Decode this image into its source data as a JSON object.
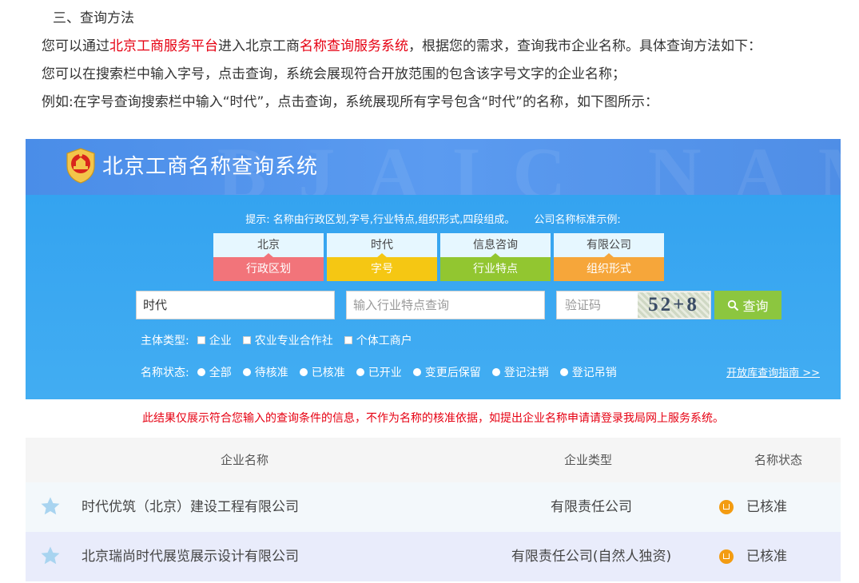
{
  "intro": {
    "section_title": "三、查询方法",
    "line1_a": "您可以通过",
    "line1_link1": "北京工商服务平台",
    "line1_b": "进入北京工商",
    "line1_link2": "名称查询服务系统",
    "line1_c": "，根据您的需求，查询我市企业名称。具体查询方法如下：",
    "line2": "您可以在搜索栏中输入字号，点击查询，系统会展现符合开放范围的包含该字号文字的企业名称；",
    "line3": "例如:在字号查询搜索栏中输入“时代”，点击查询，系统展现所有字号包含“时代”的名称，如下图所示："
  },
  "system": {
    "title": "北京工商名称查询系统",
    "banner_watermark": "BJAIC NAME"
  },
  "tip": {
    "a": "提示: 名称由行政区划,字号,行业特点,组织形式,四段组成。",
    "b": "公司名称标准示例:"
  },
  "name_parts": [
    {
      "example": "北京",
      "label": "行政区划",
      "color": "#f2747a"
    },
    {
      "example": "时代",
      "label": "字号",
      "color": "#f5c713"
    },
    {
      "example": "信息咨询",
      "label": "行业特点",
      "color": "#92c630"
    },
    {
      "example": "有限公司",
      "label": "组织形式",
      "color": "#f6a63a"
    }
  ],
  "search": {
    "name_value": "时代",
    "industry_placeholder": "输入行业特点查询",
    "captcha_placeholder": "验证码",
    "captcha_text": "52+8",
    "button_label": "查询"
  },
  "filters": {
    "entity_label": "主体类型:",
    "entity_options": [
      "企业",
      "农业专业合作社",
      "个体工商户"
    ],
    "status_label": "名称状态:",
    "status_options": [
      "全部",
      "待核准",
      "已核准",
      "已开业",
      "变更后保留",
      "登记注销",
      "登记吊销"
    ],
    "guide_link": "开放库查询指南 >>"
  },
  "notice": "此结果仅展示符合您输入的查询条件的信息，不作为名称的核准依据，如提出企业名称申请请登录我局网上服务系统。",
  "table": {
    "headers": {
      "name": "企业名称",
      "type": "企业类型",
      "status": "名称状态"
    },
    "rows": [
      {
        "name": "时代优筑（北京）建设工程有限公司",
        "type": "有限责任公司",
        "status": "已核准"
      },
      {
        "name": "北京瑞尚时代展览展示设计有限公司",
        "type": "有限责任公司(自然人独资)",
        "status": "已核准"
      }
    ]
  },
  "colors": {
    "accent_red": "#e60012",
    "banner_blue": "#4a8de8",
    "search_blue": "#3da8f0",
    "button_green": "#8cc63f",
    "status_orange": "#f39c12",
    "star_blue": "#a8d4f0"
  }
}
